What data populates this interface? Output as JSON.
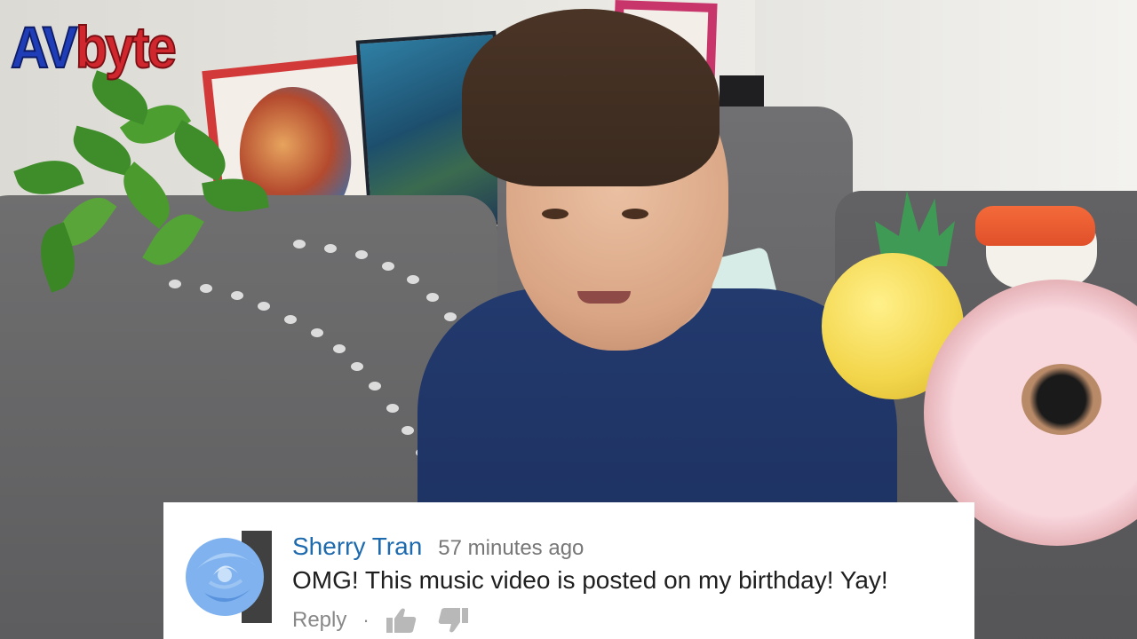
{
  "watermark": {
    "part1": "AV",
    "part2": "byte"
  },
  "comment": {
    "author": "Sherry Tran",
    "time": "57 minutes ago",
    "text": "OMG! This music video is posted on my birthday! Yay!",
    "reply_label": "Reply",
    "separator": "·",
    "icons": {
      "avatar": "blue-rose-avatar",
      "like": "thumbs-up-icon",
      "dislike": "thumbs-down-icon"
    }
  },
  "colors": {
    "author_link": "#1e6aae",
    "meta_gray": "#777777",
    "logo_blue": "#1f3db6",
    "logo_red": "#d0262e",
    "shirt_navy": "#233a6e"
  }
}
